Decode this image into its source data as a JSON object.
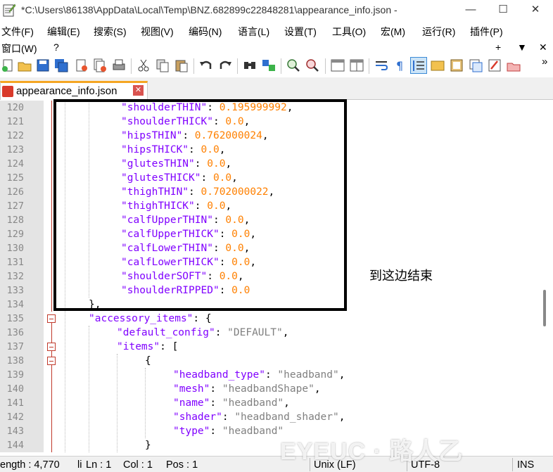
{
  "window": {
    "title": "*C:\\Users\\86138\\AppData\\Local\\Temp\\BNZ.682899c22848281\\appearance_info.json -",
    "minimize": "—",
    "maximize": "☐",
    "close": "✕"
  },
  "menu": {
    "items": [
      "文件(F)",
      "编辑(E)",
      "搜索(S)",
      "视图(V)",
      "编码(N)",
      "语言(L)",
      "设置(T)",
      "工具(O)",
      "宏(M)",
      "运行(R)",
      "插件(P)"
    ],
    "row2": [
      "窗口(W)",
      "?"
    ],
    "row2_right": [
      "+",
      "▼",
      "✕"
    ]
  },
  "toolbar": {
    "icons": [
      "new-file-icon",
      "open-file-icon",
      "save-icon",
      "save-all-icon",
      "close-file-icon",
      "close-all-icon",
      "print-icon",
      "cut-icon",
      "copy-icon",
      "paste-icon",
      "undo-icon",
      "redo-icon",
      "find-icon",
      "replace-icon",
      "zoom-in-icon",
      "zoom-out-icon",
      "sync-vertical-icon",
      "sync-horizontal-icon",
      "word-wrap-icon",
      "show-all-chars-icon",
      "indent-guide-icon",
      "user-language-icon",
      "document-map-icon",
      "function-list-icon",
      "folder-workspace-icon",
      "monitoring-icon",
      "record-macro-icon"
    ],
    "overflow": "»"
  },
  "tab": {
    "label": "appearance_info.json",
    "close": "✕"
  },
  "editor": {
    "lines": [
      {
        "num": "120",
        "key": "\"shoulderTHIN\"",
        "val": "0.195999992",
        "tail": ","
      },
      {
        "num": "121",
        "key": "\"shoulderTHICK\"",
        "val": "0.0",
        "tail": ","
      },
      {
        "num": "122",
        "key": "\"hipsTHIN\"",
        "val": "0.762000024",
        "tail": ","
      },
      {
        "num": "123",
        "key": "\"hipsTHICK\"",
        "val": "0.0",
        "tail": ","
      },
      {
        "num": "124",
        "key": "\"glutesTHIN\"",
        "val": "0.0",
        "tail": ","
      },
      {
        "num": "125",
        "key": "\"glutesTHICK\"",
        "val": "0.0",
        "tail": ","
      },
      {
        "num": "126",
        "key": "\"thighTHIN\"",
        "val": "0.702000022",
        "tail": ","
      },
      {
        "num": "127",
        "key": "\"thighTHICK\"",
        "val": "0.0",
        "tail": ","
      },
      {
        "num": "128",
        "key": "\"calfUpperTHIN\"",
        "val": "0.0",
        "tail": ","
      },
      {
        "num": "129",
        "key": "\"calfUpperTHICK\"",
        "val": "0.0",
        "tail": ","
      },
      {
        "num": "130",
        "key": "\"calfLowerTHIN\"",
        "val": "0.0",
        "tail": ","
      },
      {
        "num": "131",
        "key": "\"calfLowerTHICK\"",
        "val": "0.0",
        "tail": ","
      },
      {
        "num": "132",
        "key": "\"shoulderSOFT\"",
        "val": "0.0",
        "tail": ","
      },
      {
        "num": "133",
        "key": "\"shoulderRIPPED\"",
        "val": "0.0",
        "tail": ""
      },
      {
        "num": "134",
        "text": "},"
      },
      {
        "num": "135",
        "key": "\"accessory_items\"",
        "text": "{"
      },
      {
        "num": "136",
        "key": "\"default_config\"",
        "str": "\"DEFAULT\"",
        "tail": ","
      },
      {
        "num": "137",
        "key": "\"items\"",
        "text": "["
      },
      {
        "num": "138",
        "text": "{"
      },
      {
        "num": "139",
        "key": "\"headband_type\"",
        "str": "\"headband\"",
        "tail": ","
      },
      {
        "num": "140",
        "key": "\"mesh\"",
        "str": "\"headbandShape\"",
        "tail": ","
      },
      {
        "num": "141",
        "key": "\"name\"",
        "str": "\"headband\"",
        "tail": ","
      },
      {
        "num": "142",
        "key": "\"shader\"",
        "str": "\"headband_shader\"",
        "tail": ","
      },
      {
        "num": "143",
        "key": "\"type\"",
        "str": "\"headband\"",
        "tail": ""
      },
      {
        "num": "144",
        "text": "}"
      }
    ]
  },
  "annotation": "到这边结束",
  "status": {
    "length": "ength : 4,770",
    "lines": "li",
    "ln": "Ln : 1",
    "col": "Col : 1",
    "pos": "Pos : 1",
    "eol": "Unix (LF)",
    "encoding": "UTF-8",
    "mode": "INS"
  },
  "watermark": "EYEUC · 路人乙"
}
